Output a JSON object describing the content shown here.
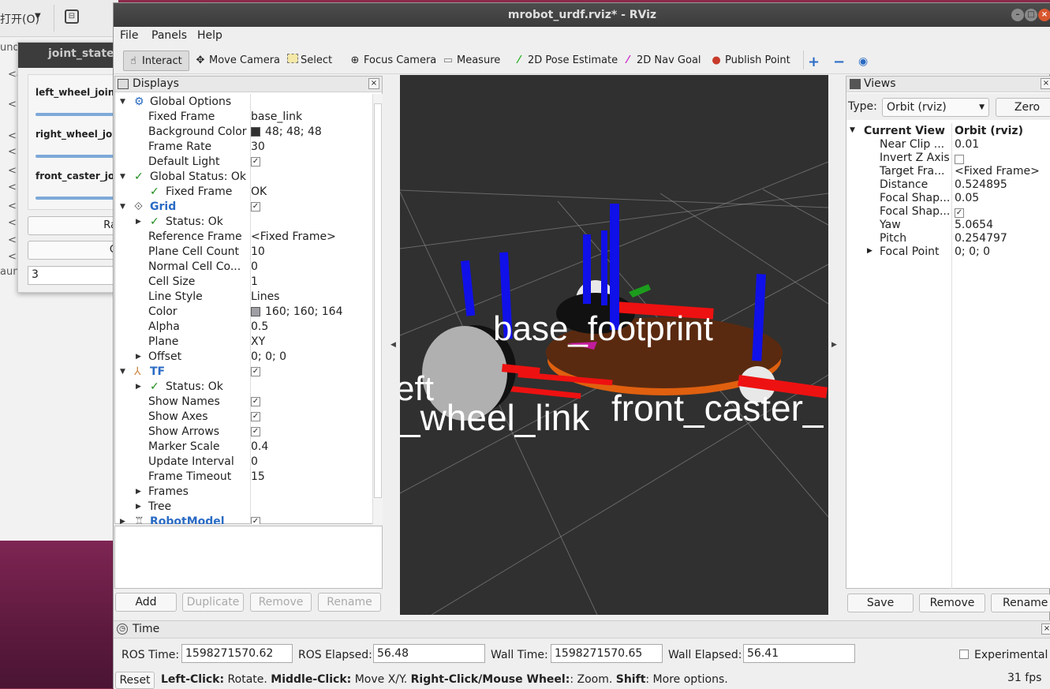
{
  "desktop": {
    "top_menu": "打开(O)",
    "left_text": "und",
    "left_text2": "aun",
    "bracket_items": [
      "<a",
      "<|",
      "<",
      "<l",
      "<",
      "<l",
      "<",
      "<l",
      "<",
      "<l"
    ]
  },
  "joint_state": {
    "title": "joint_state_",
    "joints": [
      "left_wheel_joint",
      "right_wheel_joi",
      "front_caster_joi"
    ],
    "btn1": "Ra",
    "btn2": "C",
    "input_value": "3"
  },
  "rviz": {
    "title": "mrobot_urdf.rviz* - RViz",
    "menu": [
      "File",
      "Panels",
      "Help"
    ],
    "tools": [
      {
        "label": "Interact",
        "icon": "hand-icon"
      },
      {
        "label": "Move Camera",
        "icon": "move-camera-icon"
      },
      {
        "label": "Select",
        "icon": "select-icon"
      },
      {
        "label": "Focus Camera",
        "icon": "focus-camera-icon"
      },
      {
        "label": "Measure",
        "icon": "measure-icon"
      },
      {
        "label": "2D Pose Estimate",
        "icon": "pose-estimate-icon"
      },
      {
        "label": "2D Nav Goal",
        "icon": "nav-goal-icon"
      },
      {
        "label": "Publish Point",
        "icon": "publish-point-icon"
      }
    ],
    "displays": {
      "title": "Displays",
      "rows": [
        {
          "k": "Global Options",
          "v": ""
        },
        {
          "k": "Fixed Frame",
          "v": "base_link"
        },
        {
          "k": "Background Color",
          "v": "48; 48; 48"
        },
        {
          "k": "Frame Rate",
          "v": "30"
        },
        {
          "k": "Default Light",
          "v": ""
        },
        {
          "k": "Global Status: Ok",
          "v": ""
        },
        {
          "k": "Fixed Frame",
          "v": "OK"
        },
        {
          "k": "Grid",
          "v": ""
        },
        {
          "k": "Status: Ok",
          "v": ""
        },
        {
          "k": "Reference Frame",
          "v": "<Fixed Frame>"
        },
        {
          "k": "Plane Cell Count",
          "v": "10"
        },
        {
          "k": "Normal Cell Co...",
          "v": "0"
        },
        {
          "k": "Cell Size",
          "v": "1"
        },
        {
          "k": "Line Style",
          "v": "Lines"
        },
        {
          "k": "Color",
          "v": "160; 160; 164"
        },
        {
          "k": "Alpha",
          "v": "0.5"
        },
        {
          "k": "Plane",
          "v": "XY"
        },
        {
          "k": "Offset",
          "v": "0; 0; 0"
        },
        {
          "k": "TF",
          "v": ""
        },
        {
          "k": "Status: Ok",
          "v": ""
        },
        {
          "k": "Show Names",
          "v": ""
        },
        {
          "k": "Show Axes",
          "v": ""
        },
        {
          "k": "Show Arrows",
          "v": ""
        },
        {
          "k": "Marker Scale",
          "v": "0.4"
        },
        {
          "k": "Update Interval",
          "v": "0"
        },
        {
          "k": "Frame Timeout",
          "v": "15"
        },
        {
          "k": "Frames",
          "v": ""
        },
        {
          "k": "Tree",
          "v": ""
        },
        {
          "k": "RobotModel",
          "v": ""
        }
      ],
      "buttons": [
        "Add",
        "Duplicate",
        "Remove",
        "Rename"
      ],
      "bg_color": "#303030",
      "grid_color": "#a0a0a4"
    },
    "view3d_labels": {
      "base": "base_footprint",
      "left": "_wheel_link",
      "left2": "eft",
      "front": "front_caster_"
    },
    "views": {
      "title": "Views",
      "type_label": "Type:",
      "type_value": "Orbit (rviz)",
      "zero": "Zero",
      "rows": [
        {
          "k": "Current View",
          "v": "Orbit (rviz)"
        },
        {
          "k": "Near Clip ...",
          "v": "0.01"
        },
        {
          "k": "Invert Z Axis",
          "v": ""
        },
        {
          "k": "Target Fra...",
          "v": "<Fixed Frame>"
        },
        {
          "k": "Distance",
          "v": "0.524895"
        },
        {
          "k": "Focal Shap...",
          "v": "0.05"
        },
        {
          "k": "Focal Shap...",
          "v": ""
        },
        {
          "k": "Yaw",
          "v": "5.0654"
        },
        {
          "k": "Pitch",
          "v": "0.254797"
        },
        {
          "k": "Focal Point",
          "v": "0; 0; 0"
        }
      ],
      "buttons": [
        "Save",
        "Remove",
        "Rename"
      ]
    },
    "time": {
      "title": "Time",
      "ros_time_label": "ROS Time:",
      "ros_time": "1598271570.62",
      "ros_elapsed_label": "ROS Elapsed:",
      "ros_elapsed": "56.48",
      "wall_time_label": "Wall Time:",
      "wall_time": "1598271570.65",
      "wall_elapsed_label": "Wall Elapsed:",
      "wall_elapsed": "56.41",
      "experimental": "Experimental",
      "reset": "Reset",
      "hint_left_b": "Left-Click:",
      "hint_left": " Rotate. ",
      "hint_mid_b": "Middle-Click:",
      "hint_mid": " Move X/Y. ",
      "hint_right_b": "Right-Click/Mouse Wheel:",
      "hint_right": ": Zoom. ",
      "hint_shift_b": "Shift",
      "hint_shift": ": More options.",
      "fps": "31 fps"
    }
  }
}
